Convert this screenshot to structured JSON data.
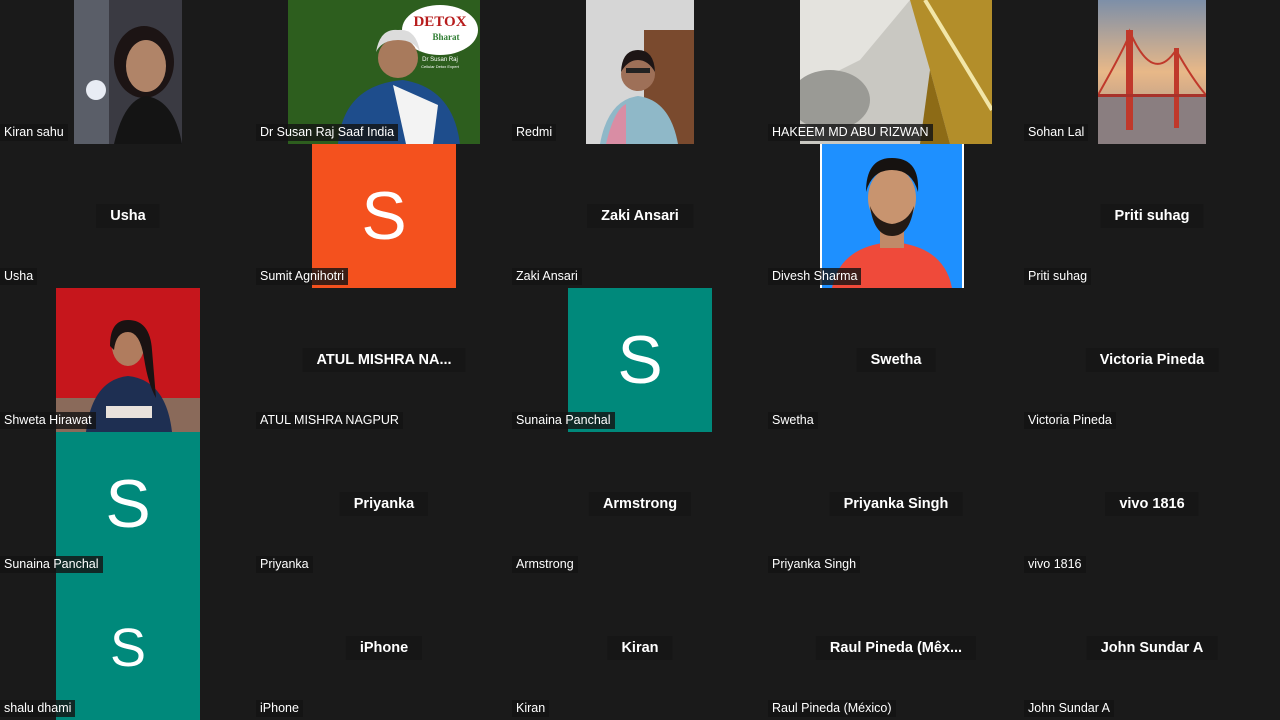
{
  "participants": {
    "kiran_sahu": {
      "label": "Kiran sahu"
    },
    "susan_raj": {
      "label": "Dr Susan Raj Saaf India",
      "logo_title": "DETOX",
      "logo_sub": "Bharat",
      "logo_name": "Dr Susan Raj",
      "logo_role": "Cellular Detox Expert"
    },
    "redmi": {
      "label": "Redmi"
    },
    "hakeem": {
      "label": "HAKEEM MD ABU RIZWAN"
    },
    "sohan_lal": {
      "label": "Sohan Lal"
    },
    "usha": {
      "label": "Usha",
      "center": "Usha"
    },
    "sumit": {
      "label": "Sumit Agnihotri",
      "initial": "S",
      "color": "#f4511e"
    },
    "zaki": {
      "label": "Zaki Ansari",
      "center": "Zaki Ansari"
    },
    "divesh": {
      "label": "Divesh Sharma"
    },
    "priti": {
      "label": "Priti suhag",
      "center": "Priti suhag"
    },
    "shweta": {
      "label": "Shweta Hirawat"
    },
    "atul": {
      "label": "ATUL MISHRA NAGPUR",
      "center": "ATUL MISHRA NA..."
    },
    "sunaina_1": {
      "label": "Sunaina Panchal",
      "initial": "S",
      "color": "#00897b"
    },
    "swetha": {
      "label": "Swetha",
      "center": "Swetha"
    },
    "victoria": {
      "label": "Victoria Pineda",
      "center": "Victoria Pineda"
    },
    "sunaina_2": {
      "label": "Sunaina Panchal",
      "initial": "S",
      "color": "#00897b"
    },
    "priyanka": {
      "label": "Priyanka",
      "center": "Priyanka"
    },
    "armstrong": {
      "label": "Armstrong",
      "center": "Armstrong"
    },
    "priyanka_singh": {
      "label": "Priyanka Singh",
      "center": "Priyanka Singh"
    },
    "vivo": {
      "label": "vivo 1816",
      "center": "vivo 1816"
    },
    "shalu": {
      "label": "shalu dhami",
      "initial": "S",
      "color": "#00897b"
    },
    "iphone": {
      "label": "iPhone",
      "center": "iPhone"
    },
    "kiran": {
      "label": "Kiran",
      "center": "Kiran"
    },
    "raul": {
      "label": "Raul Pineda (México)",
      "center": "Raul Pineda (Mêx..."
    },
    "john": {
      "label": "John Sundar A",
      "center": "John Sundar A"
    }
  }
}
